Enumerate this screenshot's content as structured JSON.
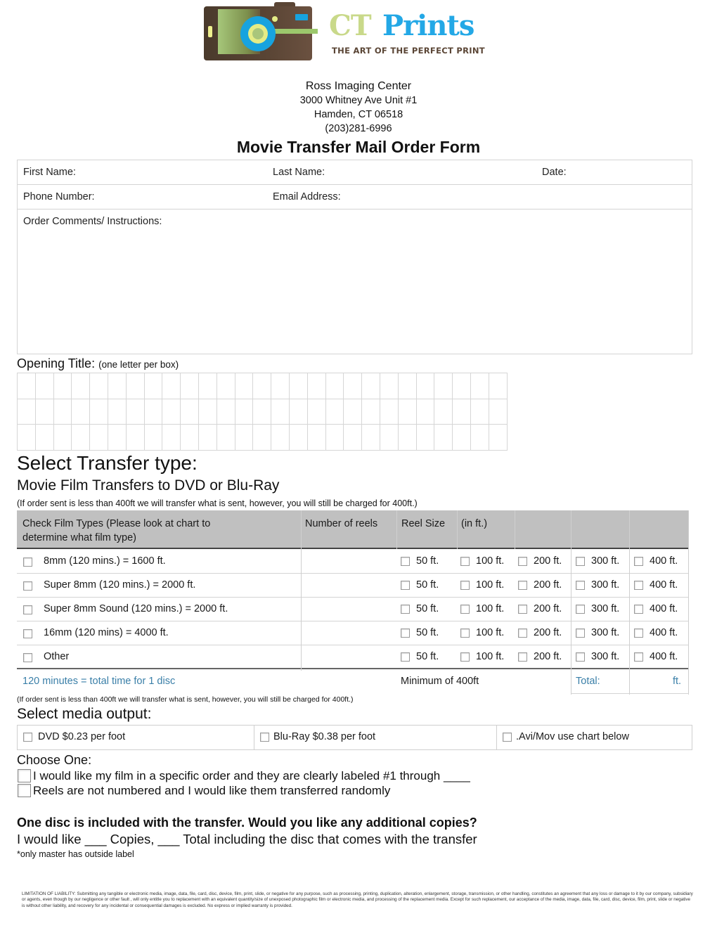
{
  "logo": {
    "brand_part1": "CT",
    "brand_part2": "Prints",
    "tagline": "THE ART OF THE PERFECT PRINT",
    "colors": {
      "brown": "#5a4535",
      "blue": "#23a8e6",
      "green": "#c9d98a"
    }
  },
  "header": {
    "business_name": "Ross Imaging Center",
    "address_line1": "3000 Whitney Ave Unit #1",
    "address_line2": "Hamden, CT 06518",
    "phone": "(203)281-6996",
    "form_title": "Movie Transfer Mail Order Form"
  },
  "info": {
    "first_name_label": "First Name:",
    "last_name_label": "Last Name:",
    "date_label": "Date:",
    "phone_label": "Phone Number:",
    "email_label": "Email Address:",
    "comments_label": "Order Comments/ Instructions:"
  },
  "opening_title": {
    "label": "Opening Title:",
    "hint": "(one letter per box)",
    "columns": 27,
    "rows": 3
  },
  "transfer": {
    "heading": "Select Transfer type:",
    "subheading": "Movie Film Transfers to DVD or Blu-Ray",
    "note": "(If order sent is less than 400ft we will transfer what is sent, however, you will still be charged for 400ft.)",
    "headers": {
      "film_types": "Check Film Types  (Please look at chart to determine what film type)",
      "num_reels": "Number of reels",
      "reel_size": "Reel Size",
      "in_ft": "(in ft.)"
    },
    "rows": [
      {
        "label": "8mm (120 mins.) = 1600 ft."
      },
      {
        "label": "Super 8mm (120 mins.) = 2000 ft."
      },
      {
        "label": "Super 8mm Sound (120 mins.) = 2000 ft."
      },
      {
        "label": "16mm (120 mins) = 4000 ft."
      },
      {
        "label": "Other"
      }
    ],
    "reel_sizes": [
      "50 ft.",
      "100 ft.",
      "200 ft.",
      "300 ft.",
      "400 ft."
    ],
    "footer": {
      "disc_note": "120 minutes = total time for 1 disc",
      "minimum": "Minimum of 400ft",
      "total_label": "Total:",
      "total_unit": "ft."
    },
    "accent_color": "#3a7fa8",
    "header_bg": "#c0c0c0"
  },
  "media": {
    "note": "(If order sent is less than 400ft we will transfer what is sent, however, you will still be charged for 400ft.)",
    "heading": "Select media output:",
    "options": [
      {
        "label": "DVD $0.23 per foot"
      },
      {
        "label": "Blu-Ray $0.38 per foot"
      },
      {
        "label": ".Avi/Mov use chart below"
      }
    ]
  },
  "choose": {
    "heading": "Choose One:",
    "options": [
      {
        "label": "I would like my film in a specific order and they are clearly labeled #1 through ____"
      },
      {
        "label": "Reels are not numbered and I would like them transferred randomly"
      }
    ]
  },
  "copies": {
    "question": "One disc is included with the transfer. Would you like any additional copies?",
    "line": "I would like ___ Copies, ___ Total including the disc that comes with the transfer",
    "footnote": "*only master has outside label"
  },
  "legal": {
    "text": "LIMITATION OF LIABILITY: Submitting any tangible or electronic media, image, data, file, card, disc, device, film, print, slide, or negative for any purpose, such as processing, printing, duplication, alteration, enlargement, storage, transmission, or other handling, constitutes an agreement that any loss or damage to it by our company, subsidiary or agents, even though by our negligence or other fault , will only entitle you to replacement with an equivalent quantity/size of unexposed photographic film or electronic media, and processing of the replacement media. Except for such replacement, our acceptance of the media, image, data, file, card, disc, device, film, print, slide or negative is without other liability, and recovery for any incidental or consequential damages is excluded. No express or implied warranty is provided."
  }
}
